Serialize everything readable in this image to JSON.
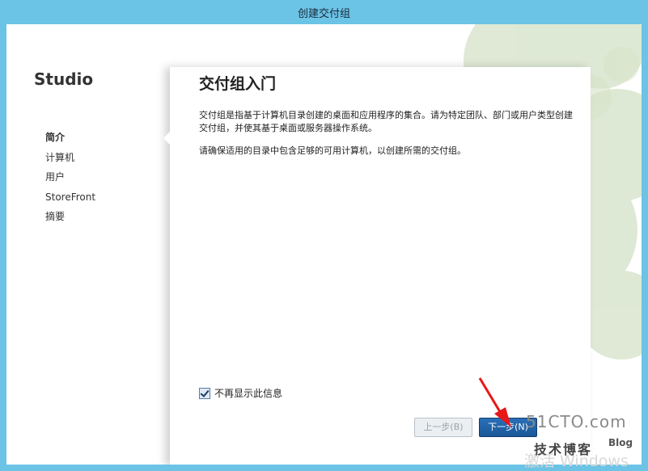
{
  "window": {
    "title": "创建交付组"
  },
  "sidebar": {
    "product": "Studio",
    "items": [
      {
        "label": "简介",
        "active": true
      },
      {
        "label": "计算机",
        "active": false
      },
      {
        "label": "用户",
        "active": false
      },
      {
        "label": "StoreFront",
        "active": false
      },
      {
        "label": "摘要",
        "active": false
      }
    ]
  },
  "main": {
    "heading": "交付组入门",
    "paragraph1": "交付组是指基于计算机目录创建的桌面和应用程序的集合。请为特定团队、部门或用户类型创建交付组，并使其基于桌面或服务器操作系统。",
    "paragraph2": "请确保适用的目录中包含足够的可用计算机，以创建所需的交付组。",
    "checkbox": {
      "label": "不再显示此信息",
      "checked": true
    }
  },
  "buttons": {
    "back": "上一步(B)",
    "next": "下一步(N)"
  },
  "watermark": {
    "logo": "51CTO.com",
    "sub": "技术博客",
    "blog": "Blog",
    "activate": "激活 Windows"
  },
  "colors": {
    "accent": "#6bc3e6",
    "primary_button": "#1a5798",
    "arrow": "#e81818",
    "decor_green": "#b8cfa3"
  }
}
